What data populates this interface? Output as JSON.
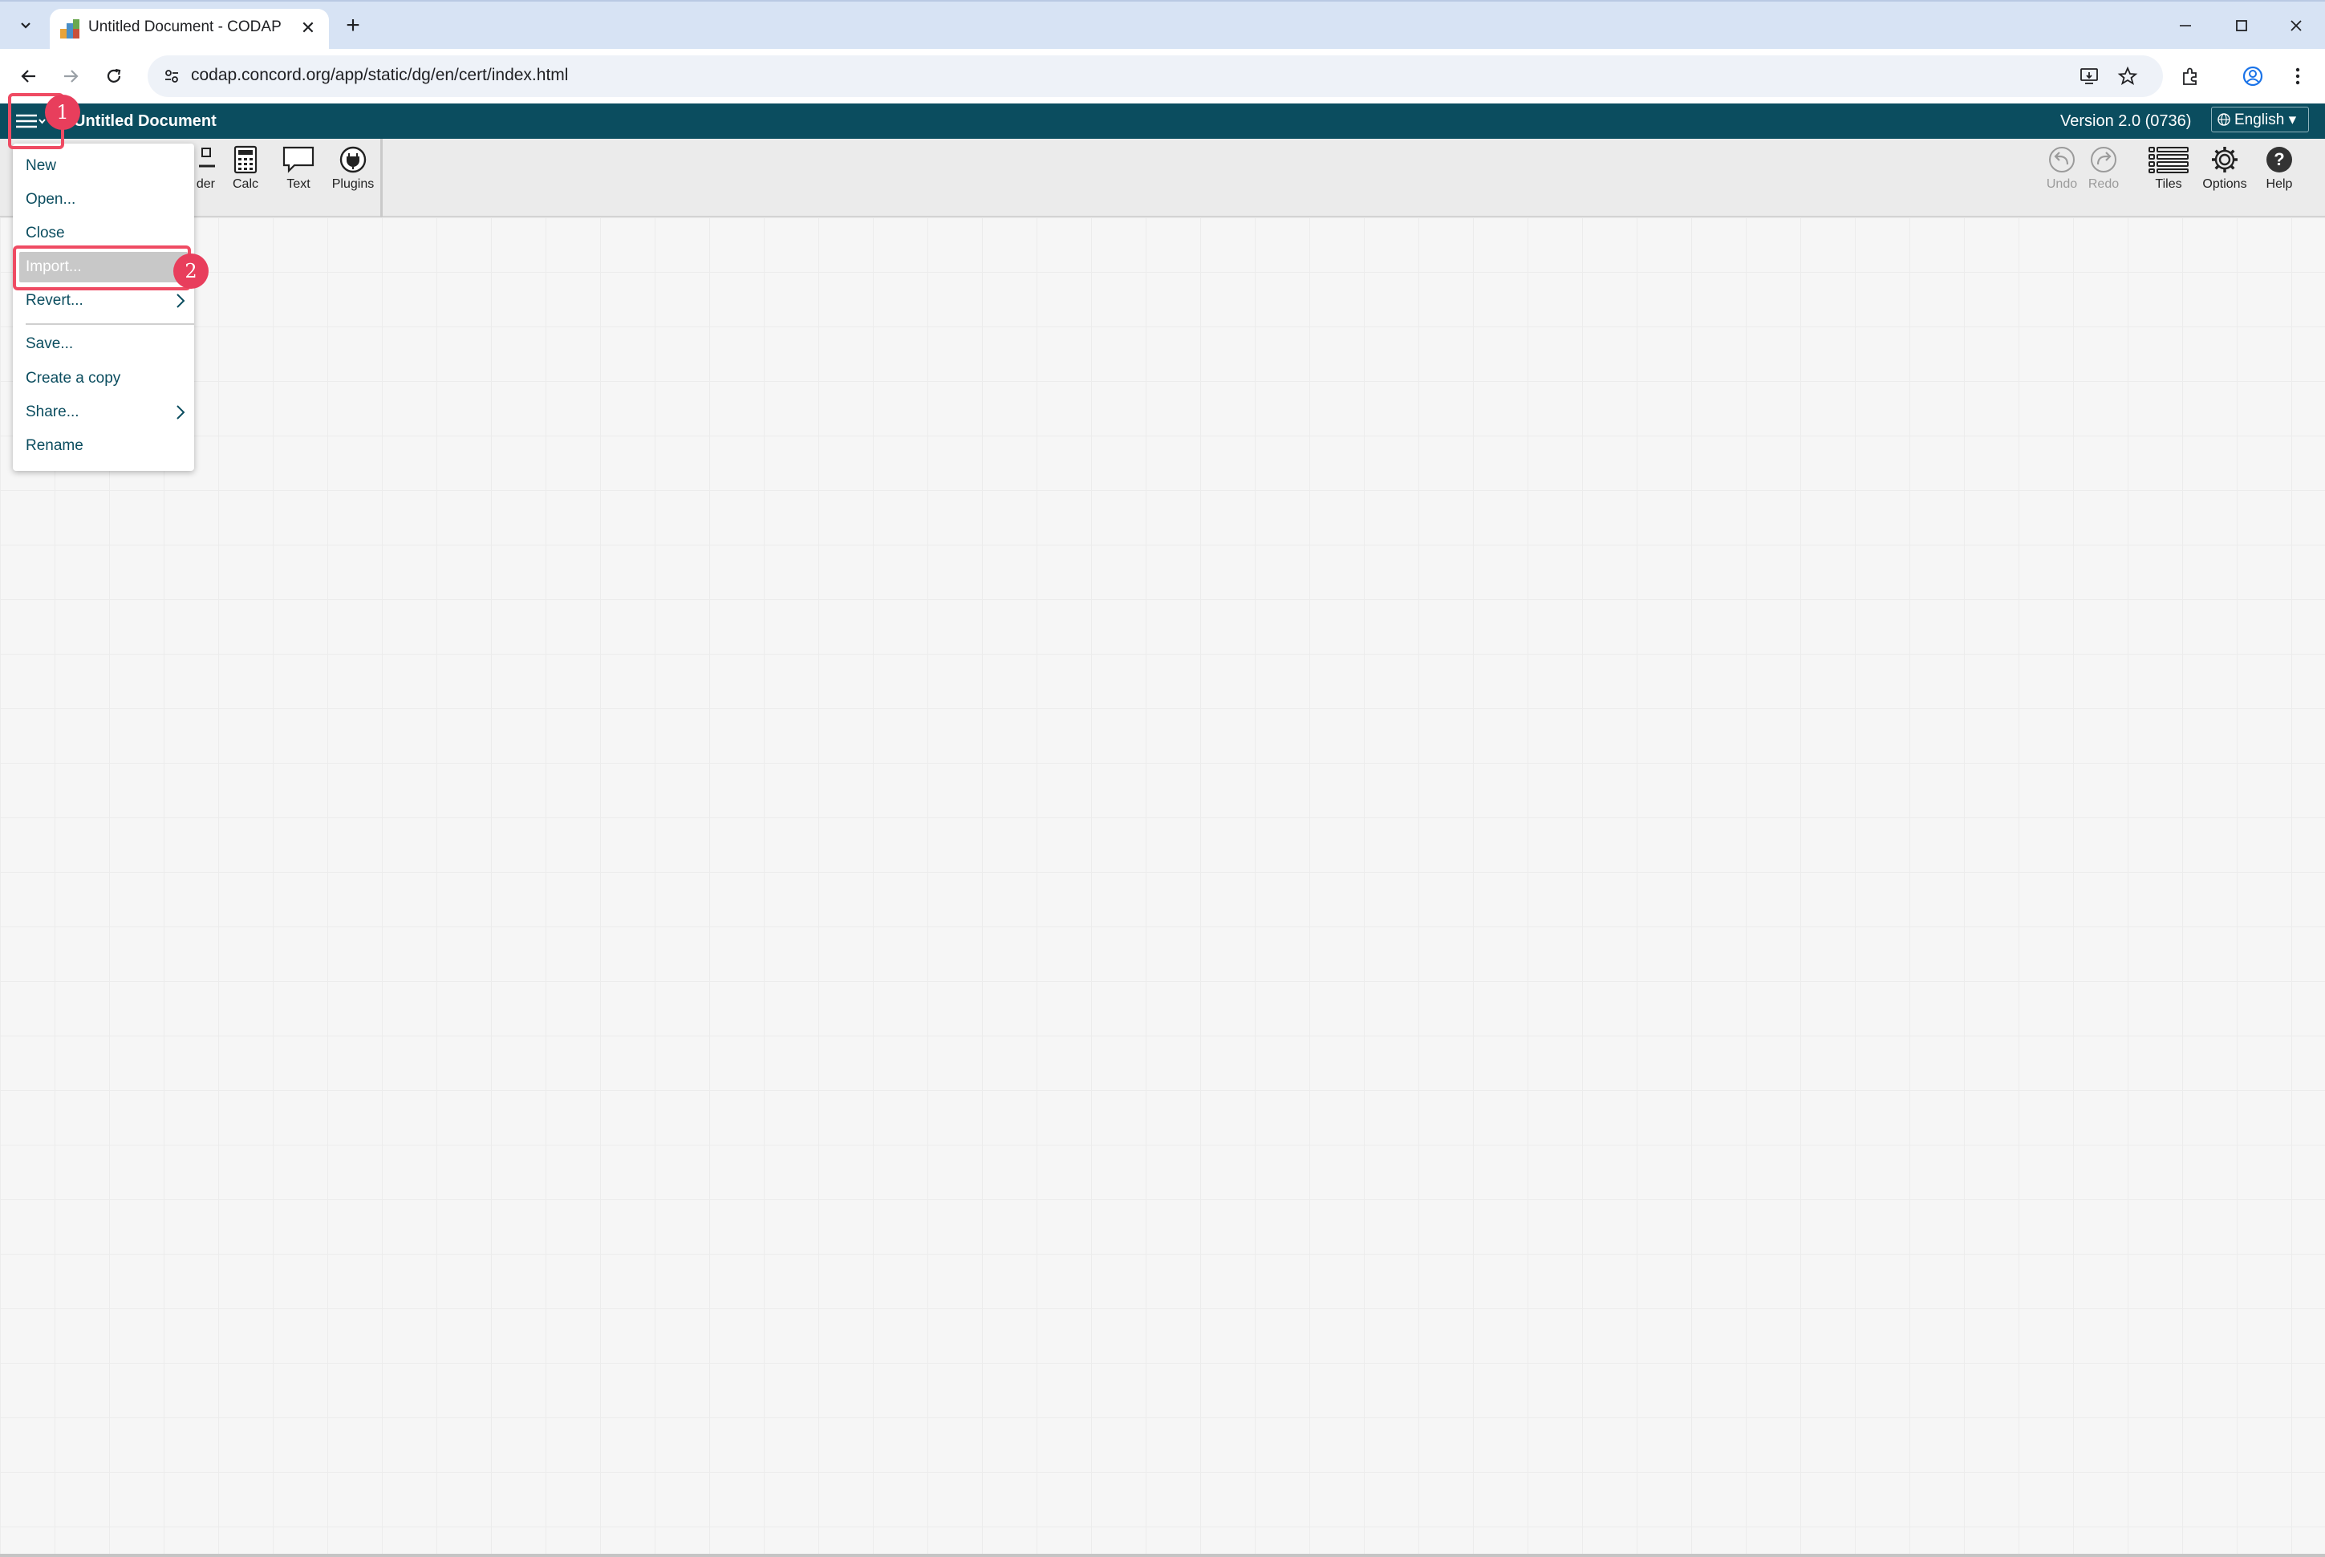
{
  "browser": {
    "tab_title": "Untitled Document - CODAP",
    "tab_close": "✕",
    "new_tab": "+",
    "url": "codap.concord.org/app/static/dg/en/cert/index.html"
  },
  "app": {
    "document_title": "Untitled Document",
    "version": "Version 2.0 (0736)",
    "language": "English ▾",
    "tools": {
      "slider_partial": "der",
      "calc": "Calc",
      "text": "Text",
      "plugins": "Plugins",
      "undo": "Undo",
      "redo": "Redo",
      "tiles": "Tiles",
      "options": "Options",
      "help": "Help"
    },
    "file_menu": {
      "new": "New",
      "open": "Open...",
      "close": "Close",
      "import": "Import...",
      "revert": "Revert...",
      "save": "Save...",
      "create_copy": "Create a copy",
      "share": "Share...",
      "rename": "Rename"
    }
  },
  "annotations": {
    "marker_1": "1",
    "marker_2": "2"
  },
  "colors": {
    "menubar": "#0b4d5f",
    "annotation": "#e83e5c",
    "menu_text": "#0b4d5f"
  }
}
